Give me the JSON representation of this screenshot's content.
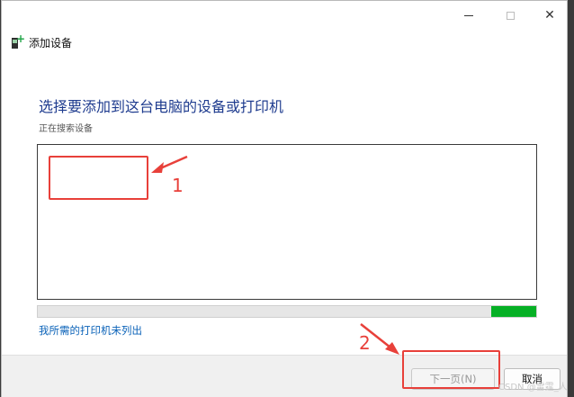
{
  "window": {
    "title": "添加设备",
    "close_glyph": "✕",
    "icon": "device-add-icon"
  },
  "main": {
    "heading": "选择要添加到这台电脑的设备或打印机",
    "status": "正在搜索设备",
    "progress_fraction": 0.09,
    "printer_not_listed": "我所需的打印机未列出"
  },
  "footer": {
    "next_label": "下一页(N)",
    "cancel_label": "取消"
  },
  "annotations": {
    "label_1": "1",
    "label_2": "2",
    "color": "#e8403a"
  },
  "watermark": "CSDN @雷霆_人",
  "colors": {
    "heading": "#1f3c8f",
    "link": "#0a62b8",
    "progress": "#06b025"
  }
}
